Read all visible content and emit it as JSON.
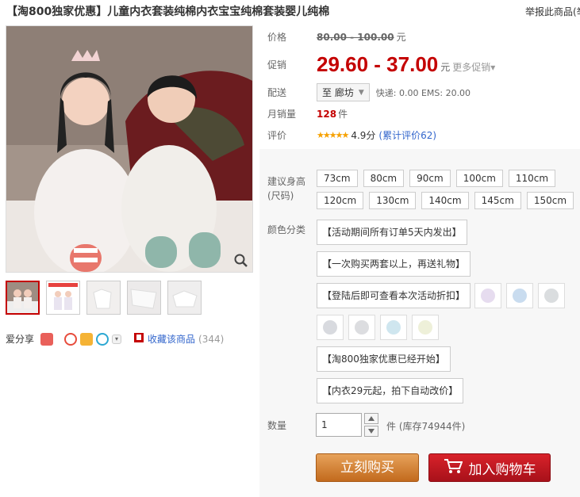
{
  "product": {
    "title": "【淘800独家优惠】儿童内衣套装纯棉内衣宝宝纯棉套装婴儿纯棉",
    "report_link": "举报此商品(举"
  },
  "gallery": {
    "thumbnails_count": 5
  },
  "share": {
    "label": "爱分享",
    "favorite_label": "收藏该商品",
    "favorite_count": "(344)"
  },
  "price": {
    "label": "价格",
    "original": "80.00 - 100.00",
    "unit": "元"
  },
  "promo": {
    "label": "促销",
    "price": "29.60 - 37.00",
    "unit": "元",
    "more": "更多促销"
  },
  "shipping": {
    "label": "配送",
    "destination": "至 廊坊",
    "fees": "快递: 0.00 EMS: 20.00"
  },
  "monthly_sales": {
    "label": "月销量",
    "count": "128",
    "unit": "件"
  },
  "rating": {
    "label": "评价",
    "stars": "★★★★★",
    "score": "4.9分",
    "reviews": "(累计评价62)"
  },
  "sizes": {
    "label": "建议身高(尺码)",
    "options": [
      "73cm",
      "80cm",
      "90cm",
      "100cm",
      "110cm",
      "120cm",
      "130cm",
      "140cm",
      "145cm",
      "150cm"
    ]
  },
  "colors": {
    "label": "颜色分类",
    "options": [
      "【活动期间所有订单5天内发出】",
      "【一次购买两套以上，再送礼物】",
      "【登陆后即可查看本次活动折扣】",
      "【淘800独家优惠已经开始】",
      "【内衣29元起，拍下自动改价】"
    ],
    "swatch_colors": [
      "#e6dcef",
      "#c9dcef",
      "#dadddf",
      "#d8dadf",
      "#dcdde0",
      "#cfe6ef",
      "#eef0d9"
    ]
  },
  "quantity": {
    "label": "数量",
    "value": "1",
    "stock": "件 (库存74944件)"
  },
  "actions": {
    "buy_now": "立刻购买",
    "add_to_cart": "加入购物车"
  }
}
